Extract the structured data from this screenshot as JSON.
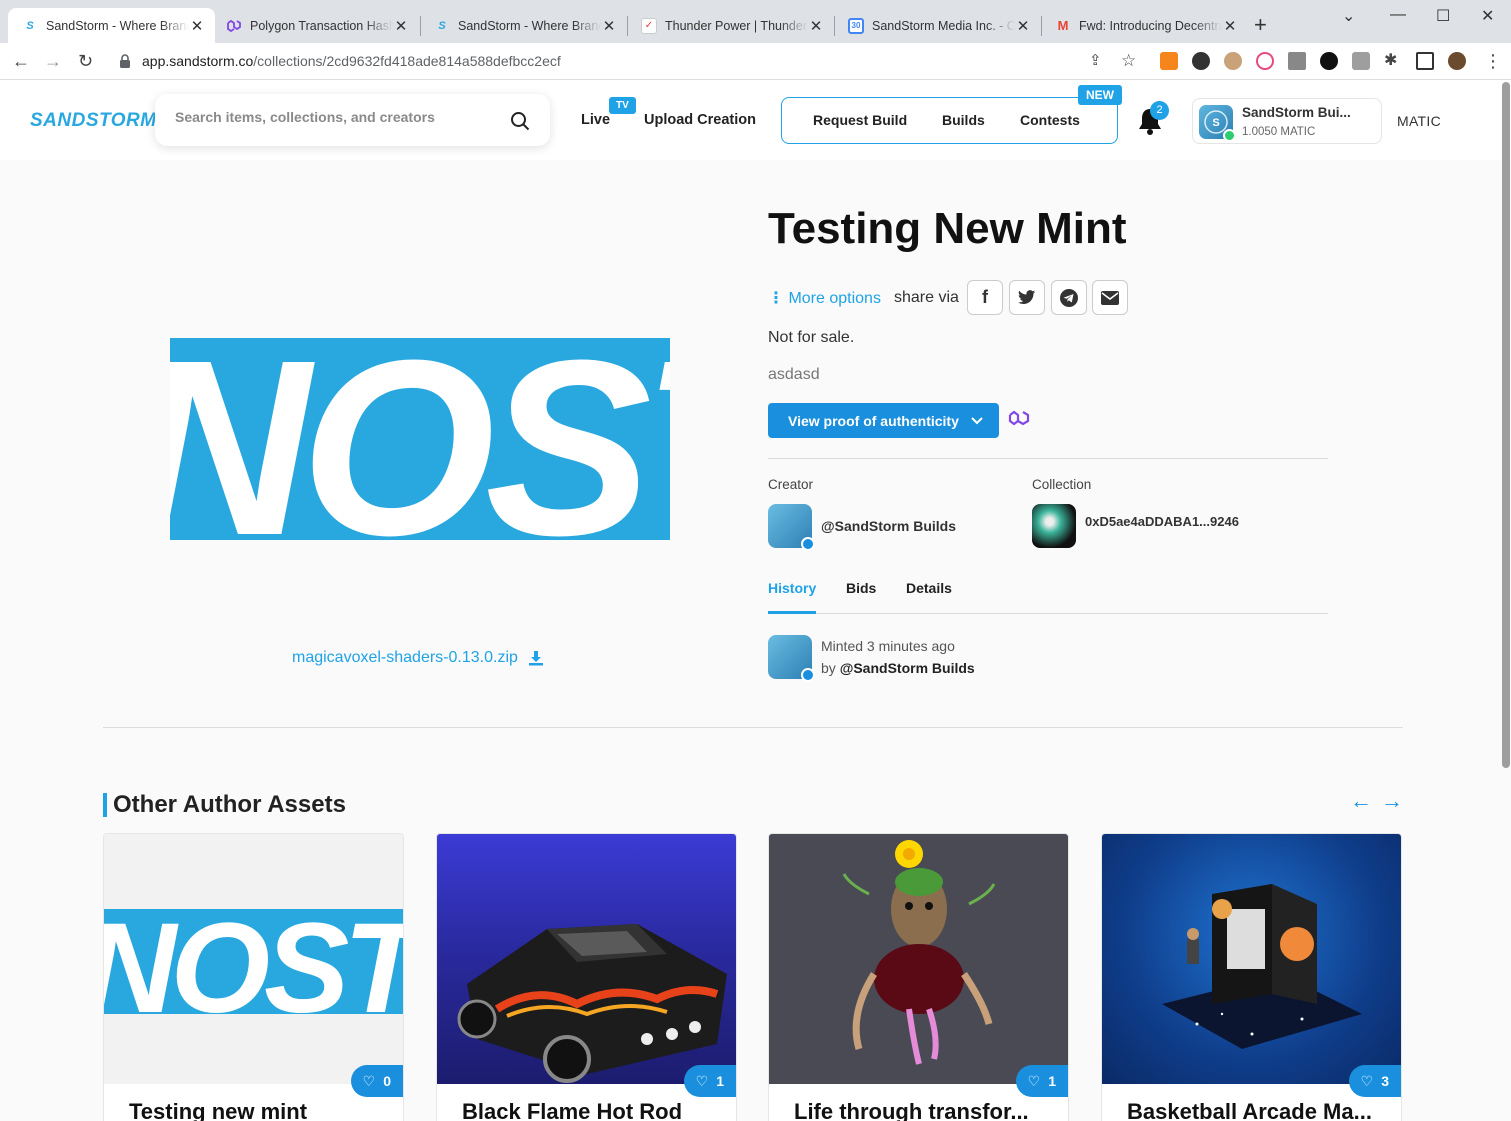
{
  "browser": {
    "tabs": [
      {
        "title": "SandStorm - Where Brands",
        "favicon": "sandstorm-favicon"
      },
      {
        "title": "Polygon Transaction Hash",
        "favicon": "polygon-favicon"
      },
      {
        "title": "SandStorm - Where Brands",
        "favicon": "sandstorm-favicon"
      },
      {
        "title": "Thunder Power | Thunder P",
        "favicon": "thunder-favicon"
      },
      {
        "title": "SandStorm Media Inc. - Ca",
        "favicon": "calendar-favicon"
      },
      {
        "title": "Fwd: Introducing Decentra",
        "favicon": "gmail-favicon"
      }
    ],
    "url_host": "app.sandstorm.co",
    "url_path": "/collections/2cd9632fd418ade814a588defbcc2ecf"
  },
  "header": {
    "logo": "SANDSTORM",
    "search_placeholder": "Search items, collections, and creators",
    "live": "Live",
    "tv_badge": "TV",
    "upload": "Upload Creation",
    "request_build": "Request Build",
    "builds": "Builds",
    "contests": "Contests",
    "new_badge": "NEW",
    "notification_count": "2",
    "account_name": "SandStorm Bui...",
    "account_balance": "1.0050 MATIC",
    "currency": "MATIC"
  },
  "item": {
    "artwork_text": "NOST",
    "title": "Testing New Mint",
    "more_options": "More options",
    "share_via": "share via",
    "sale_status": "Not for sale.",
    "description": "asdasd",
    "proof_button": "View proof of authenticity",
    "file_name": "magicavoxel-shaders-0.13.0.zip",
    "creator_label": "Creator",
    "creator_name": "@SandStorm Builds",
    "collection_label": "Collection",
    "collection_name": "0xD5ae4aDDABA1...9246",
    "tabs": [
      "History",
      "Bids",
      "Details"
    ],
    "history": {
      "event": "Minted 3 minutes ago",
      "by": "by",
      "by_user": "@SandStorm Builds"
    }
  },
  "other_assets": {
    "title": "Other Author Assets",
    "cards": [
      {
        "title": "Testing new mint",
        "likes": "0"
      },
      {
        "title": "Black Flame Hot Rod",
        "likes": "1"
      },
      {
        "title": "Life through transfor...",
        "likes": "1"
      },
      {
        "title": "Basketball Arcade Ma...",
        "likes": "3"
      }
    ]
  },
  "colors": {
    "accent": "#1fa3e6",
    "brand_blue": "#29a8e0",
    "button_blue": "#1a8fdd"
  }
}
